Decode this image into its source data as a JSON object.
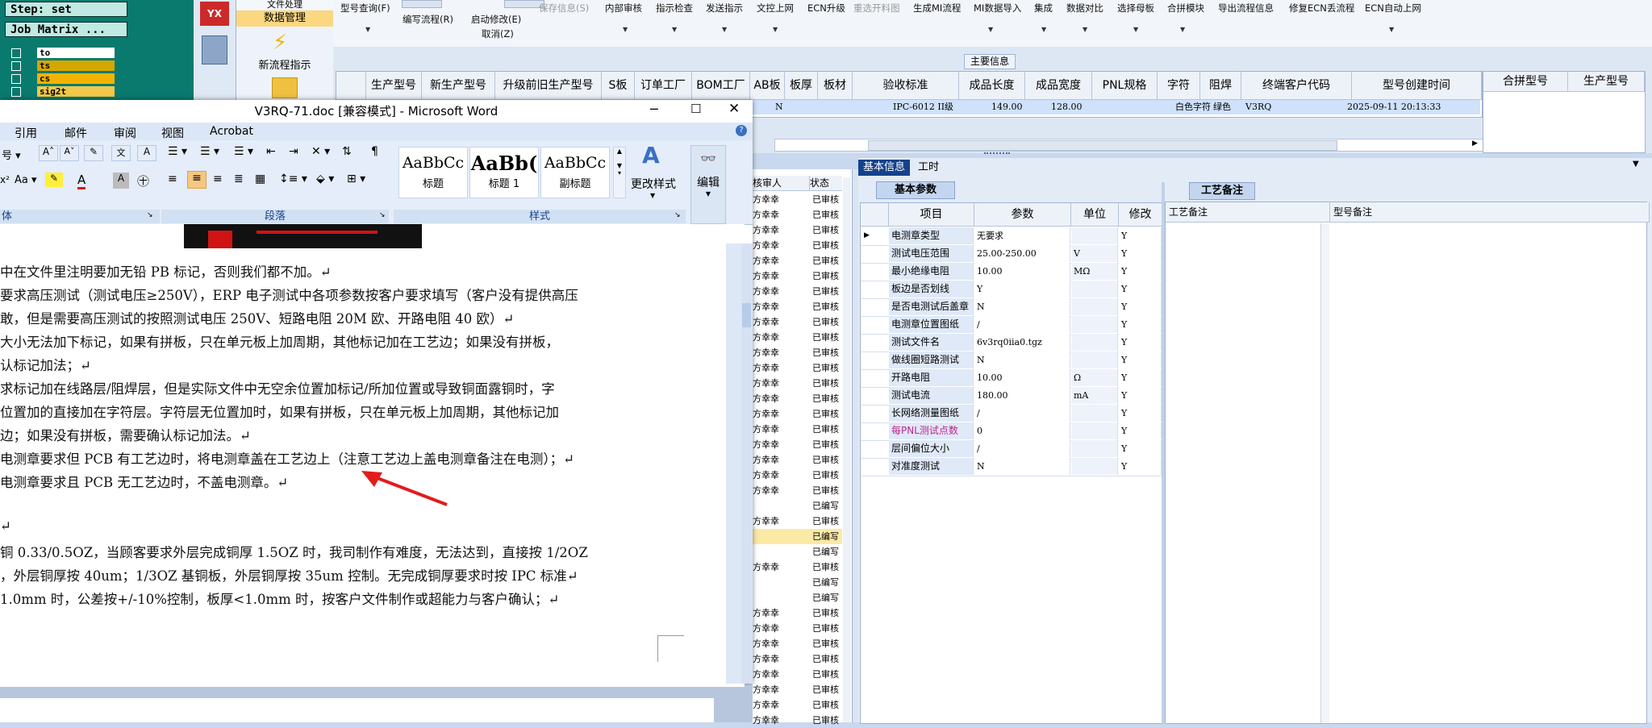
{
  "erp": {
    "step_label": "Step: set",
    "job_matrix_label": "Job Matrix ...",
    "layers": [
      "to",
      "ts",
      "cs",
      "sig2t"
    ],
    "flow_items": [
      "文件处理",
      "数据管理",
      "新流程指示"
    ],
    "menu": [
      {
        "label": "型号查询(F)",
        "sub": "",
        "disabled": false
      },
      {
        "label": "编写流程(R)",
        "sub": "",
        "disabled": false
      },
      {
        "label": "启动修改(E)",
        "sub": "取消(Z)",
        "disabled": false
      },
      {
        "label": "保存信息(S)",
        "sub": "",
        "disabled": true
      },
      {
        "label": "内部审核",
        "sub": "",
        "disabled": false
      },
      {
        "label": "指示检查",
        "sub": "",
        "disabled": false
      },
      {
        "label": "发送指示",
        "sub": "",
        "disabled": false
      },
      {
        "label": "文控上网",
        "sub": "",
        "disabled": false
      },
      {
        "label": "ECN升级",
        "sub": "",
        "disabled": false
      },
      {
        "label": "重选开料图",
        "sub": "",
        "disabled": true
      },
      {
        "label": "生成MI流程",
        "sub": "",
        "disabled": false
      },
      {
        "label": "MI数据导入",
        "sub": "",
        "disabled": false
      },
      {
        "label": "集成",
        "sub": "",
        "disabled": false
      },
      {
        "label": "数据对比",
        "sub": "",
        "disabled": false
      },
      {
        "label": "选择母板",
        "sub": "",
        "disabled": false
      },
      {
        "label": "合拼模块",
        "sub": "",
        "disabled": false
      },
      {
        "label": "导出流程信息",
        "sub": "",
        "disabled": false
      },
      {
        "label": "修复ECN丢流程",
        "sub": "",
        "disabled": false
      },
      {
        "label": "ECN自动上网",
        "sub": "",
        "disabled": false
      }
    ],
    "main_info_label": "主要信息",
    "table_headers": [
      "生产型号",
      "新生产型号",
      "升级前旧生产型号",
      "S板",
      "订单工厂",
      "BOM工厂",
      "AB板",
      "板厚",
      "板材",
      "验收标准",
      "成品长度",
      "成品宽度",
      "PNL规格",
      "字符",
      "阻焊",
      "终端客户代码",
      "型号创建时间"
    ],
    "row": [
      "",
      "",
      "",
      "",
      "",
      "",
      "N",
      "",
      "",
      "IPC-6012 II级",
      "149.00",
      "128.00",
      "",
      "白色字符",
      "绿色",
      "V3RQ",
      "2025-09-11 20:13:33"
    ],
    "right_headers": [
      "合拼型号",
      "生产型号"
    ],
    "mid_headers": [
      "核审人",
      "状态"
    ],
    "mid_rows": [
      [
        "方幸幸",
        "已审核"
      ],
      [
        "方幸幸",
        "已审核"
      ],
      [
        "方幸幸",
        "已审核"
      ],
      [
        "方幸幸",
        "已审核"
      ],
      [
        "方幸幸",
        "已审核"
      ],
      [
        "方幸幸",
        "已审核"
      ],
      [
        "方幸幸",
        "已审核"
      ],
      [
        "方幸幸",
        "已审核"
      ],
      [
        "方幸幸",
        "已审核"
      ],
      [
        "方幸幸",
        "已审核"
      ],
      [
        "方幸幸",
        "已审核"
      ],
      [
        "方幸幸",
        "已审核"
      ],
      [
        "方幸幸",
        "已审核"
      ],
      [
        "方幸幸",
        "已审核"
      ],
      [
        "方幸幸",
        "已审核"
      ],
      [
        "方幸幸",
        "已审核"
      ],
      [
        "方幸幸",
        "已审核"
      ],
      [
        "方幸幸",
        "已审核"
      ],
      [
        "方幸幸",
        "已审核"
      ],
      [
        "方幸幸",
        "已审核"
      ],
      [
        "",
        "已编写"
      ],
      [
        "方幸幸",
        "已审核"
      ],
      [
        "",
        "已编写"
      ],
      [
        "",
        "已编写"
      ],
      [
        "方幸幸",
        "已审核"
      ],
      [
        "",
        "已编写"
      ],
      [
        "",
        "已编写"
      ],
      [
        "方幸幸",
        "已审核"
      ],
      [
        "方幸幸",
        "已审核"
      ],
      [
        "方幸幸",
        "已审核"
      ],
      [
        "方幸幸",
        "已审核"
      ],
      [
        "方幸幸",
        "已审核"
      ],
      [
        "方幸幸",
        "已审核"
      ],
      [
        "方幸幸",
        "已审核"
      ],
      [
        "方幸幸",
        "已审核"
      ]
    ],
    "tabs": [
      "基本信息",
      "工时"
    ],
    "basic_tab": "基本参数",
    "tech_tab": "工艺备注",
    "grid_headers": [
      "项目",
      "参数",
      "单位",
      "修改"
    ],
    "grid_rows": [
      [
        "电测章类型",
        "无要求",
        "",
        "Y"
      ],
      [
        "测试电压范围",
        "25.00-250.00",
        "V",
        "Y"
      ],
      [
        "最小绝缘电阻",
        "10.00",
        "MΩ",
        "Y"
      ],
      [
        "板边是否划线",
        "Y",
        "",
        "Y"
      ],
      [
        "是否电测试后盖章",
        "N",
        "",
        "Y"
      ],
      [
        "电测章位置图纸",
        "/",
        "",
        "Y"
      ],
      [
        "测试文件名",
        "6v3rq0iia0.tgz",
        "",
        "Y"
      ],
      [
        "做线圈短路测试",
        "N",
        "",
        "Y"
      ],
      [
        "开路电阻",
        "10.00",
        "Ω",
        "Y"
      ],
      [
        "测试电流",
        "180.00",
        "mA",
        "Y"
      ],
      [
        "长网络测量图纸",
        "/",
        "",
        "Y"
      ],
      [
        "每PNL测试点数",
        "0",
        "",
        "Y"
      ],
      [
        "层间偏位大小",
        "/",
        "",
        "Y"
      ],
      [
        "对准度测试",
        "N",
        "",
        "Y"
      ]
    ],
    "tech_headers": [
      "工艺备注",
      "型号备注"
    ]
  },
  "word": {
    "title": "V3RQ-71.doc [兼容模式] - Microsoft Word",
    "menu": [
      "引用",
      "邮件",
      "审阅",
      "视图",
      "Acrobat"
    ],
    "style_samples": [
      {
        "sample": "AaBbCc",
        "name": "标题"
      },
      {
        "sample": "AaBb(",
        "name": "标题 1"
      },
      {
        "sample": "AaBbCc",
        "name": "副标题"
      }
    ],
    "change_styles": "更改样式",
    "edit": "编辑",
    "groups": [
      "体",
      "段落",
      "样式"
    ],
    "lines": [
      "中在文件里注明要加无铅 PB 标记，否则我们都不加。↵",
      "要求高压测试（测试电压≥250V），ERP 电子测试中各项参数按客户要求填写（客户没有提供高压",
      "敢，但是需要高压测试的按照测试电压 250V、短路电阻 20M 欧、开路电阻 40 欧）↵",
      "大小无法加下标记，如果有拼板，只在单元板上加周期，其他标记加在工艺边；如果没有拼板，",
      "认标记加法；↵",
      "求标记加在线路层/阻焊层，但是实际文件中无空余位置加标记/所加位置或导致铜面露铜时，字",
      "位置加的直接加在字符层。字符层无位置加时，如果有拼板，只在单元板上加周期，其他标记加",
      "边；如果没有拼板，需要确认标记加法。↵",
      "电测章要求但 PCB 有工艺边时，将电测章盖在工艺边上（注意工艺边上盖电测章备注在电测）；↵",
      "电测章要求且 PCB 无工艺边时，不盖电测章。↵",
      "",
      "↵",
      "铜 0.33/0.5OZ，当顾客要求外层完成铜厚 1.5OZ 时，我司制作有难度，无法达到，直接按 1/2OZ",
      "，外层铜厚按 40um；1/3OZ 基铜板，外层铜厚按 35um 控制。无完成铜厚要求时按 IPC 标准↵",
      "1.0mm 时，公差按+/-10%控制，板厚<1.0mm 时，按客户文件制作或超能力与客户确认；↵"
    ]
  },
  "colors": {
    "accent": "#15428b",
    "highlight": "#fbe9a6",
    "selected_row": "#cfe1fb",
    "annotation_arrow": "#e31b1b"
  }
}
